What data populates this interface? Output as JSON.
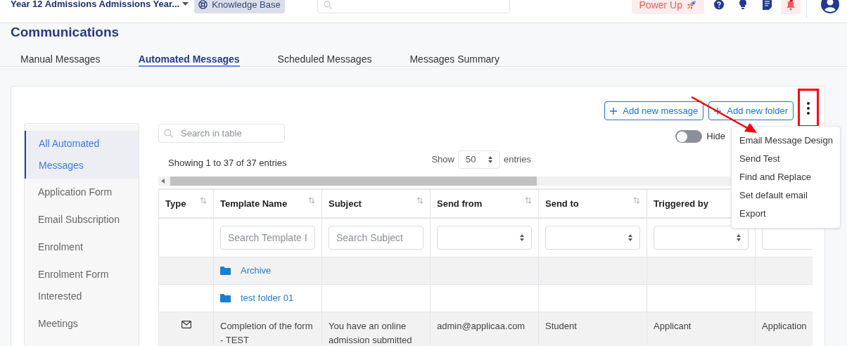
{
  "top_bar": {
    "program": "Year 12 Admissions Admissions Year...",
    "knowledge_base": "Knowledge Base",
    "power_up": "Power Up"
  },
  "page_title": "Communications",
  "tabs": [
    {
      "label": "Manual Messages",
      "selected": false
    },
    {
      "label": "Automated Messages",
      "selected": true
    },
    {
      "label": "Scheduled Messages",
      "selected": false
    },
    {
      "label": "Messages Summary",
      "selected": false
    }
  ],
  "toolbar": {
    "buttons": [
      "Add new message",
      "Add new folder"
    ],
    "toggle": {
      "label": "Hide",
      "on": false
    }
  },
  "menu": {
    "items": [
      "Email Message Design",
      "Send Test",
      "Find and Replace",
      "Set default email",
      "Export"
    ]
  },
  "sidebar": {
    "items": [
      {
        "label": "All Automated Messages",
        "selected": true
      },
      {
        "label": "Application Form",
        "selected": false
      },
      {
        "label": "Email Subscription",
        "selected": false
      },
      {
        "label": "Enrolment",
        "selected": false
      },
      {
        "label": "Enrolment Form Interested",
        "selected": false
      },
      {
        "label": "Meetings",
        "selected": false
      }
    ]
  },
  "table_search": {
    "placeholder": "Search in table"
  },
  "info": "Showing 1 to 37 of 37 entries",
  "page_size": {
    "before": "Show",
    "value": "50",
    "after": "entries"
  },
  "table": {
    "columns": [
      {
        "label": "Type",
        "sortable": true
      },
      {
        "label": "Template Name",
        "sortable": true,
        "filter": {
          "kind": "text",
          "placeholder": "Search Template I"
        }
      },
      {
        "label": "Subject",
        "sortable": true,
        "filter": {
          "kind": "text",
          "placeholder": "Search Subject"
        }
      },
      {
        "label": "Send from",
        "sortable": true,
        "filter": {
          "kind": "select"
        }
      },
      {
        "label": "Send to",
        "sortable": true,
        "filter": {
          "kind": "select"
        }
      },
      {
        "label": "Triggered by",
        "sortable": false,
        "filter": {
          "kind": "select"
        }
      },
      {
        "filter": {
          "kind": "select"
        }
      }
    ],
    "rows": [
      {
        "kind": "folder",
        "name": "Archive"
      },
      {
        "kind": "folder",
        "name": "test folder 01"
      },
      {
        "kind": "message",
        "cells": [
          "Completion of the form - TEST",
          "You have an online admission submitted",
          "admin@applicaa.com",
          "Student",
          "Applicant",
          "Application"
        ]
      }
    ]
  }
}
